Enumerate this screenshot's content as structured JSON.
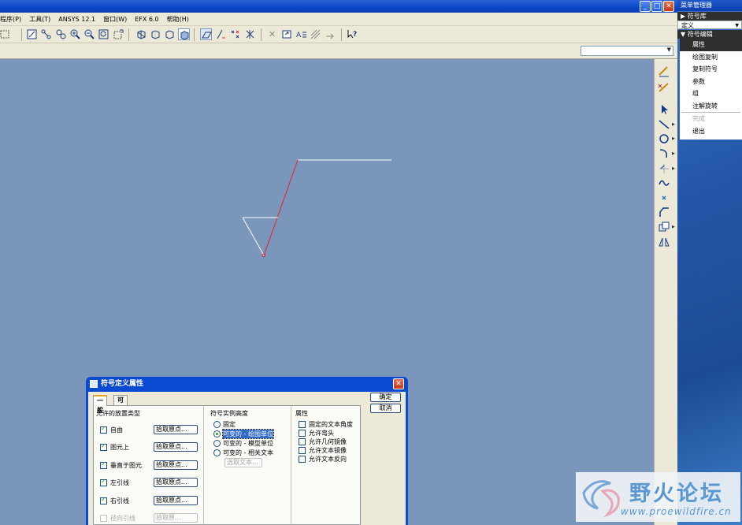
{
  "menubar": {
    "items": [
      "程序(P)",
      "工具(T)",
      "ANSYS 12.1",
      "窗口(W)",
      "EFX 6.0",
      "帮助(H)"
    ]
  },
  "window_buttons": {
    "minimize": "_",
    "maximize": "□",
    "close": "✕"
  },
  "menu_manager": {
    "title": "菜单管理器",
    "library_header": "▶ 符号库",
    "define_value": "定义",
    "edit_header": "▼ 符号编辑",
    "items": [
      {
        "label": "属性",
        "state": "active"
      },
      {
        "label": "绘图复制",
        "state": "normal"
      },
      {
        "label": "复制符号",
        "state": "normal"
      },
      {
        "label": "参数",
        "state": "normal"
      },
      {
        "label": "组",
        "state": "normal"
      },
      {
        "label": "注解旋转",
        "state": "normal"
      },
      {
        "label": "完成",
        "state": "disabled"
      },
      {
        "label": "退出",
        "state": "normal"
      }
    ]
  },
  "dialog": {
    "title": "符号定义属性",
    "close": "✕",
    "ok_label": "确定",
    "cancel_label": "取消",
    "tabs": [
      "一般",
      "可变文本"
    ],
    "placement": {
      "heading": "允许的放置类型",
      "options": [
        {
          "label": "自由",
          "checked": true,
          "enabled": true,
          "button": "拾取原点..."
        },
        {
          "label": "图元上",
          "checked": true,
          "enabled": true,
          "button": "拾取原点..."
        },
        {
          "label": "垂直于图元",
          "checked": true,
          "enabled": true,
          "button": "拾取原点..."
        },
        {
          "label": "左引线",
          "checked": true,
          "enabled": true,
          "button": "拾取原点..."
        },
        {
          "label": "右引线",
          "checked": true,
          "enabled": true,
          "button": "拾取原点..."
        },
        {
          "label": "径向引线",
          "checked": false,
          "enabled": false,
          "button": "拾取原..."
        }
      ]
    },
    "height": {
      "heading": "符号实例高度",
      "options": [
        {
          "label": "固定",
          "selected": false
        },
        {
          "label": "可变的 - 绘图单位",
          "selected": true
        },
        {
          "label": "可变的 - 模型单位",
          "selected": false
        },
        {
          "label": "可变的 - 相关文本",
          "selected": false
        }
      ],
      "select_text": "选取文本..."
    },
    "attributes": {
      "heading": "属性",
      "options": [
        {
          "label": "固定的文本角度",
          "checked": false
        },
        {
          "label": "允许弯头",
          "checked": false
        },
        {
          "label": "允许几何镜像",
          "checked": false
        },
        {
          "label": "允许文本镜像",
          "checked": false
        },
        {
          "label": "允许文本反向",
          "checked": false
        }
      ]
    }
  },
  "watermark": {
    "title": "野火论坛",
    "url": "www.proewildfire.cn"
  }
}
